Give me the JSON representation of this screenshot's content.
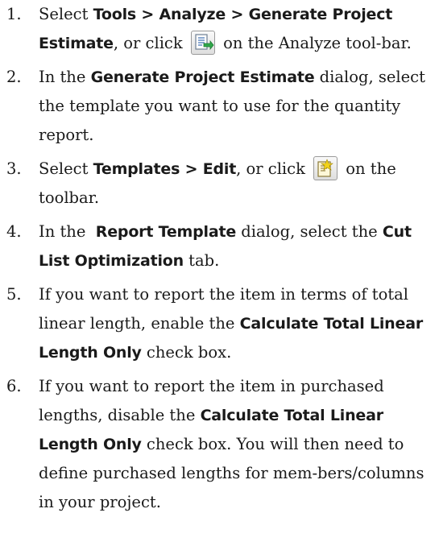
{
  "steps": [
    {
      "number": "1.",
      "t1": "Select ",
      "b1": "Tools > Analyze > Generate Project Estimate",
      "t2": ", or click ",
      "icon": "generate-estimate-icon",
      "t3": " on the Analyze tool-bar."
    },
    {
      "number": "2.",
      "t1": "In the ",
      "b1": "Generate Project Estimate",
      "t2": " dialog, select the template you want to use for the quantity report."
    },
    {
      "number": "3.",
      "t1": "Select ",
      "b1": "Templates > Edit",
      "t2": ", or click ",
      "icon": "edit-template-icon",
      "t3": " on the toolbar."
    },
    {
      "number": "4.",
      "t1": "In the  ",
      "b1": "Report Template",
      "t2": " dialog, select the ",
      "b2": "Cut List Optimization",
      "t3": " tab."
    },
    {
      "number": "5.",
      "t1": "If you want to report the item in terms of total linear length, enable the ",
      "b1": "Calculate Total Linear Length Only",
      "t2": " check box."
    },
    {
      "number": "6.",
      "t1": "If you want to report the item in purchased lengths, disable the ",
      "b1": "Calculate Total Linear Length Only",
      "t2": " check box. You will then need to define purchased lengths for mem-bers/columns in your project."
    }
  ]
}
